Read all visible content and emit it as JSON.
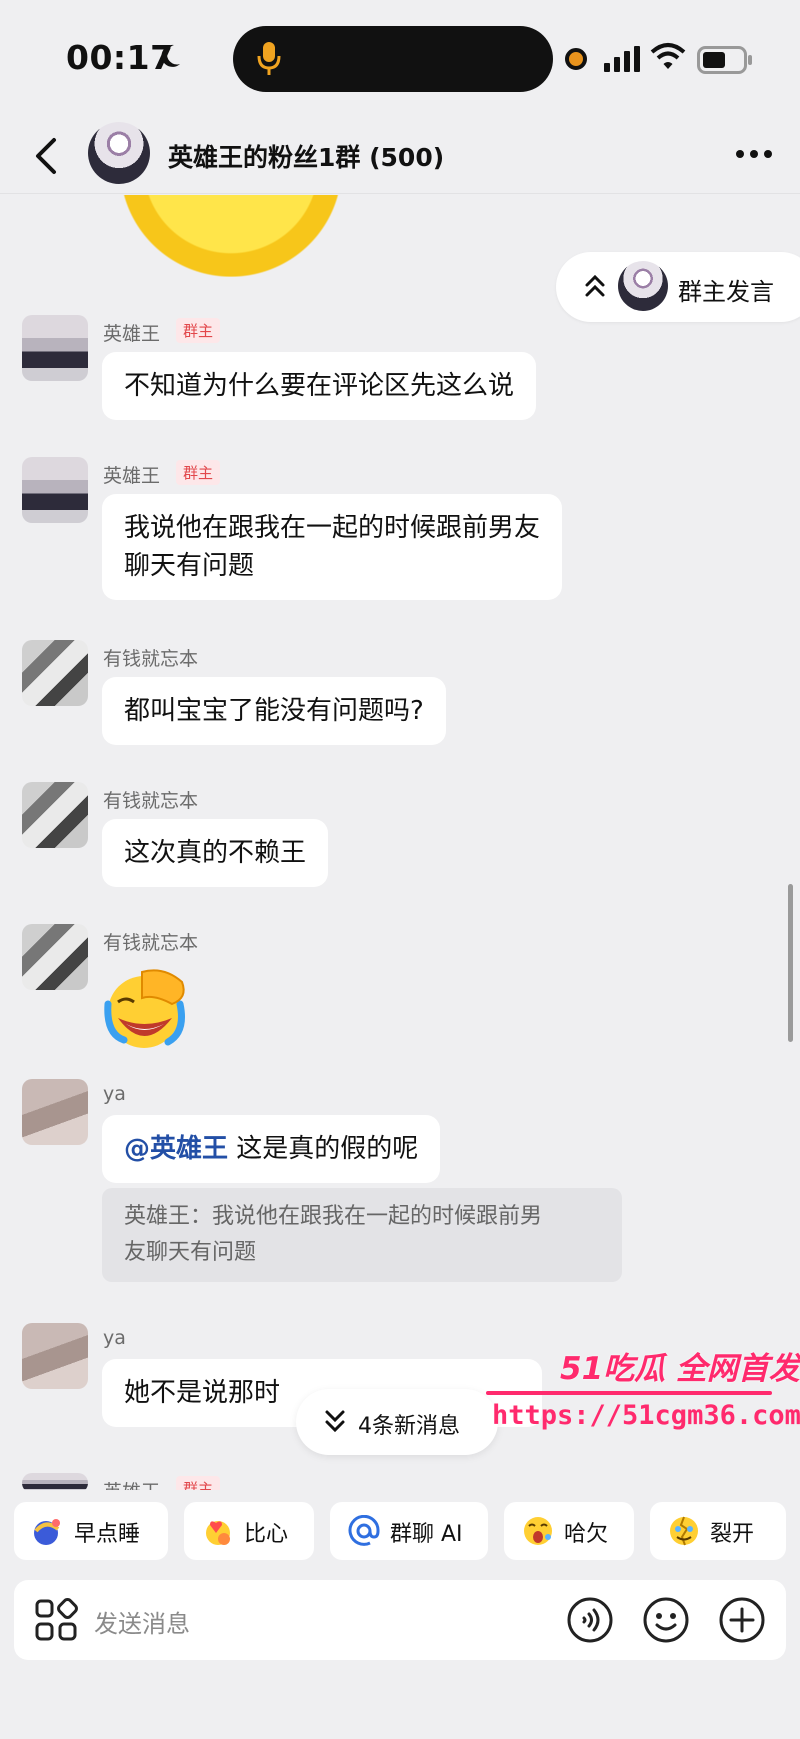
{
  "status": {
    "time": "00:17"
  },
  "header": {
    "title": "英雄王的粉丝1群 (500)"
  },
  "owner_pill": {
    "label": "群主发言"
  },
  "badges": {
    "owner": "群主"
  },
  "messages": [
    {
      "name": "英雄王",
      "text": "不知道为什么要在评论区先这么说"
    },
    {
      "name": "英雄王",
      "line1": "我说他在跟我在一起的时候跟前男友",
      "line2": "聊天有问题"
    },
    {
      "name": "有钱就忘本",
      "text": "都叫宝宝了能没有问题吗?"
    },
    {
      "name": "有钱就忘本",
      "text": "这次真的不赖王"
    },
    {
      "name": "有钱就忘本",
      "emoji": "facepalm-laugh-icon"
    },
    {
      "name": "ya",
      "mention": "@英雄王",
      "text": " 这是真的假的呢",
      "quote_line1": "英雄王：我说他在跟我在一起的时候跟前男",
      "quote_line2": "友聊天有问题"
    },
    {
      "name": "ya",
      "text": "她不是说那时"
    },
    {
      "name": "英雄王"
    }
  ],
  "new_messages": {
    "label": "4条新消息"
  },
  "watermark": {
    "title": "51吃瓜 全网首发",
    "url": "https://51cgm36.com"
  },
  "quick_replies": [
    {
      "label": "早点睡",
      "icon": "moon-bed-icon"
    },
    {
      "label": "比心",
      "icon": "heart-hand-icon"
    },
    {
      "label": "群聊 AI",
      "icon": "at-icon"
    },
    {
      "label": "哈欠",
      "icon": "yawn-icon"
    },
    {
      "label": "裂开",
      "icon": "crack-face-icon"
    }
  ],
  "input": {
    "placeholder": "发送消息"
  },
  "colors": {
    "background": "#efeff1",
    "badge_red": "#e2474b",
    "mention_blue": "#234fa6",
    "watermark_pink": "#ff2a6d"
  }
}
